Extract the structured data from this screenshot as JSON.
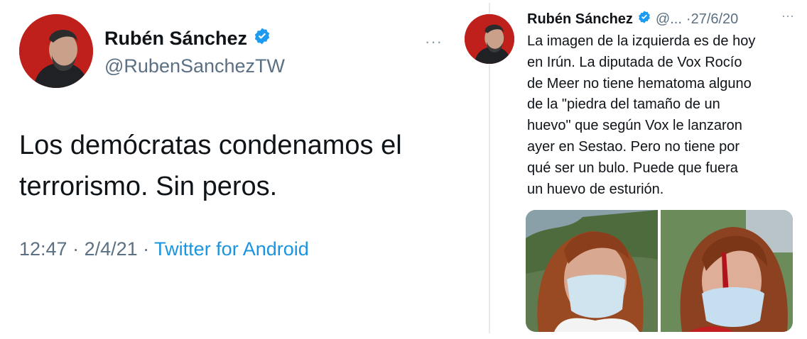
{
  "main_tweet": {
    "display_name": "Rubén Sánchez",
    "handle": "@RubenSanchezTW",
    "more_glyph": "···",
    "text_line1": "Los demócratas condenamos el",
    "text_line2": "terrorismo. Sin peros.",
    "time": "12:47",
    "separator1": " · ",
    "date": "2/4/21",
    "separator2": " · ",
    "source": "Twitter for Android"
  },
  "quoted_tweet": {
    "display_name": "Rubén Sánchez",
    "handle": "@...",
    "date": "·27/6/20",
    "more_glyph": "···",
    "lines": [
      "La imagen de la izquierda es de hoy",
      "en Irún. La diputada de Vox Rocío",
      "de Meer no tiene hematoma alguno",
      "de la \"piedra del tamaño de un",
      "huevo\" que según Vox le lanzaron",
      "ayer en Sestao. Pero no tiene por",
      "qué ser un bulo. Puede que fuera",
      "un huevo de esturión."
    ]
  },
  "icons": {
    "verified": "verified-badge-icon",
    "more": "more-options-icon"
  },
  "colors": {
    "verified_blue": "#1d9bf0",
    "link_blue": "#1b95e0",
    "secondary_text": "#5b7083",
    "avatar_bg": "#c0201b"
  }
}
